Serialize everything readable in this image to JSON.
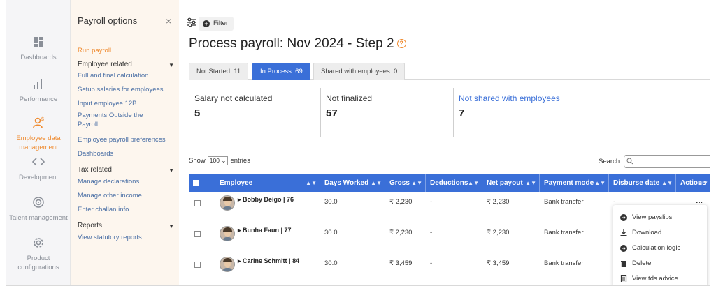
{
  "rail": {
    "items": [
      {
        "label": "Dashboards",
        "icon": "dashboard-icon"
      },
      {
        "label": "Performance",
        "icon": "bar-chart-icon"
      },
      {
        "label": "Employee data management",
        "icon": "employee-data-icon"
      },
      {
        "label": "Development",
        "icon": "code-icon"
      },
      {
        "label": "Talent management",
        "icon": "talent-icon"
      },
      {
        "label": "Product configurations",
        "icon": "gear-icon"
      }
    ]
  },
  "options": {
    "title": "Payroll options",
    "close": "×",
    "run_payroll": "Run payroll",
    "employee_related": "Employee related",
    "employee_links": [
      "Full and final calculation",
      "Setup salaries for employees",
      "Input employee 12B",
      "Payments Outside the Payroll",
      "Employee payroll preferences",
      "Dashboards"
    ],
    "tax_related": "Tax related",
    "tax_links": [
      "Manage declarations",
      "Manage other income",
      "Enter challan info"
    ],
    "reports": "Reports",
    "report_links": [
      "View statutory reports"
    ]
  },
  "main": {
    "filter_label": "Filter",
    "title": "Process payroll: Nov 2024 - Step 2",
    "help": "?",
    "tabs": [
      {
        "label": "Not Started: 11",
        "active": false
      },
      {
        "label": "In Process: 69",
        "active": true
      },
      {
        "label": "Shared with employees: 0",
        "active": false
      }
    ],
    "stats": [
      {
        "label": "Salary not calculated",
        "value": "5"
      },
      {
        "label": "Not finalized",
        "value": "57"
      },
      {
        "label": "Not shared with employees",
        "value": "7"
      }
    ],
    "show_prefix": "Show",
    "entries_value": "100",
    "show_suffix": "entries",
    "search_label": "Search:",
    "search_value": "",
    "columns": [
      "Employee",
      "Days Worked",
      "Gross",
      "Deductions",
      "Net payout",
      "Payment mode",
      "Disburse date",
      "Actions"
    ],
    "rows": [
      {
        "employee": "Bobby Deigo | 76",
        "days": "30.0",
        "gross": "₹ 2,230",
        "deductions": "-",
        "net": "₹ 2,230",
        "mode": "Bank transfer",
        "disburse": "-",
        "actions": "..."
      },
      {
        "employee": "Bunha Faun | 77",
        "days": "30.0",
        "gross": "₹ 2,230",
        "deductions": "-",
        "net": "₹ 2,230",
        "mode": "Bank transfer",
        "disburse": "",
        "actions": ""
      },
      {
        "employee": "Carine Schmitt | 84",
        "days": "30.0",
        "gross": "₹ 3,459",
        "deductions": "-",
        "net": "₹ 3,459",
        "mode": "Bank transfer",
        "disburse": "",
        "actions": ""
      }
    ],
    "action_menu": [
      "View payslips",
      "Download",
      "Calculation logic",
      "Delete",
      "View tds advice"
    ]
  },
  "colors": {
    "accent": "#3a6fd8",
    "orange": "#ef8b30",
    "panel_bg": "#fdf6ee"
  }
}
